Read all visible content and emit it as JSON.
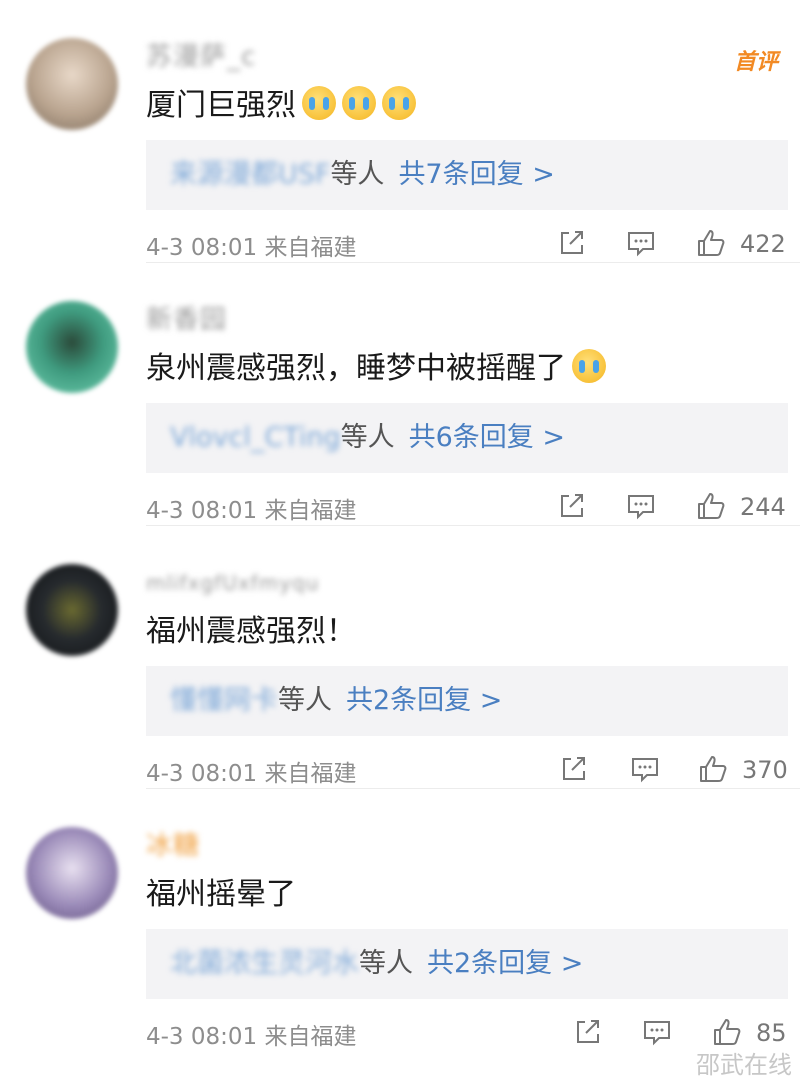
{
  "comments": [
    {
      "username": "苏漫萨_c",
      "badge": "首评",
      "text": "厦门巨强烈",
      "reply_names": "来源漫都USF",
      "reply_suffix": "等人",
      "reply_count": "共7条回复 >",
      "meta": "4-3 08:01 来自福建",
      "likes": "422",
      "avatar_color": "#b9a48f"
    },
    {
      "username": "新香园",
      "badge": "",
      "text": "泉州震感强烈，睡梦中被摇醒了",
      "reply_names": "Vlovcl_CTing",
      "reply_suffix": "等人",
      "reply_count": "共6条回复 >",
      "meta": "4-3 08:01 来自福建",
      "likes": "244",
      "avatar_color": "#3f9b7f"
    },
    {
      "username": "mlifxgfUxfmyqu",
      "badge": "",
      "text": "福州震感强烈！",
      "reply_names": "懂懂网卡",
      "reply_suffix": "等人",
      "reply_count": "共2条回复 >",
      "meta": "4-3 08:01 来自福建",
      "likes": "370",
      "avatar_color": "#262a2e"
    },
    {
      "username": "冰糖",
      "badge": "",
      "text": "福州摇晕了",
      "reply_names": "北菌浓生灵河水",
      "reply_suffix": "等人",
      "reply_count": "共2条回复 >",
      "meta": "4-3 08:01 来自福建",
      "likes": "85",
      "avatar_color": "#9a8ab8"
    }
  ],
  "watermark": "邵武在线",
  "colors": {
    "link": "#4a7fc1",
    "reply_bg": "#f3f3f5",
    "badge": "#f28a24"
  }
}
